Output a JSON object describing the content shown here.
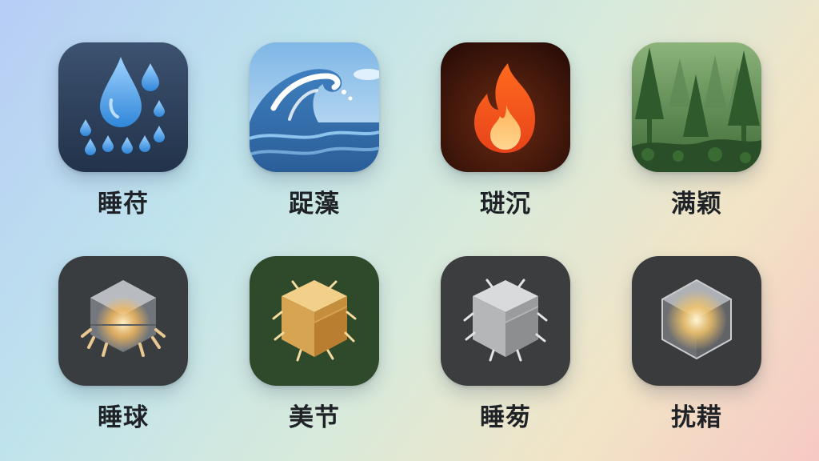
{
  "colors": {
    "background": [
      "#b7cdf6",
      "#bfe3ec",
      "#d8eadb",
      "#f2e4c6",
      "#f6c9c4"
    ],
    "label_text": "#1f2328"
  },
  "tiles": [
    {
      "label": "睡苻",
      "icon": "raindrops-icon",
      "tile_color": "#2c3e57"
    },
    {
      "label": "踀藻",
      "icon": "ocean-wave-icon",
      "tile_color": "#8ec1e6"
    },
    {
      "label": "琎沉",
      "icon": "fire-icon",
      "tile_color": "#3a140c"
    },
    {
      "label": "满颖",
      "icon": "forest-icon",
      "tile_color": "#3f6b3a"
    },
    {
      "label": "睡球",
      "icon": "glowing-crystal-cube-icon",
      "tile_color": "#3a3d40"
    },
    {
      "label": "美节",
      "icon": "hay-block-icon",
      "tile_color": "#2f4a2b"
    },
    {
      "label": "睡茐",
      "icon": "stone-block-icon",
      "tile_color": "#3b3d3f"
    },
    {
      "label": "扰耤",
      "icon": "light-cube-icon",
      "tile_color": "#3a3b3c"
    }
  ]
}
